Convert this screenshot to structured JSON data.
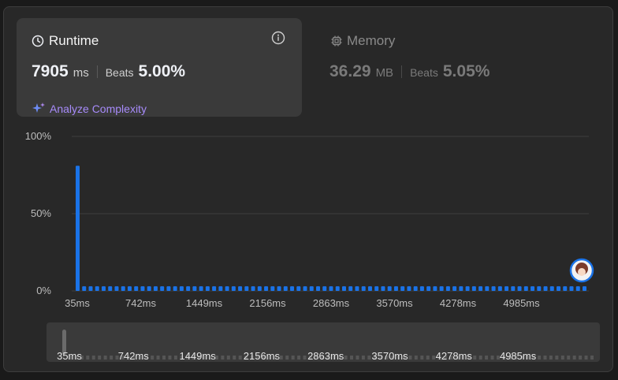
{
  "runtime": {
    "title": "Runtime",
    "value": "7905",
    "unit": "ms",
    "beats_label": "Beats",
    "beats_value": "5.00%",
    "analyze_label": "Analyze Complexity"
  },
  "memory": {
    "title": "Memory",
    "value": "36.29",
    "unit": "MB",
    "beats_label": "Beats",
    "beats_value": "5.05%"
  },
  "colors": {
    "bar": "#1a73e8",
    "analyze": "#a78bfa"
  },
  "chart_data": {
    "type": "bar",
    "yticks": [
      "100%",
      "50%",
      "0%"
    ],
    "ylim": [
      0,
      100
    ],
    "grid": true,
    "xticks": [
      "35ms",
      "742ms",
      "1449ms",
      "2156ms",
      "2863ms",
      "3570ms",
      "4278ms",
      "4985ms"
    ],
    "values": [
      81,
      3,
      3,
      3,
      3,
      3,
      3,
      3,
      3,
      3,
      3,
      3,
      3,
      3,
      3,
      3,
      3,
      3,
      3,
      3,
      3,
      3,
      3,
      3,
      3,
      3,
      3,
      3,
      3,
      3,
      3,
      3,
      3,
      3,
      3,
      3,
      3,
      3,
      3,
      3,
      3,
      3,
      3,
      3,
      3,
      3,
      3,
      3,
      3,
      3,
      3,
      3,
      3,
      3,
      3,
      3,
      3,
      3,
      3,
      3,
      3,
      3,
      3,
      3,
      3,
      3,
      3,
      3,
      3,
      3,
      3,
      3,
      3,
      3,
      3,
      3,
      3,
      3,
      3
    ]
  },
  "overview": {
    "xticks": [
      "35ms",
      "742ms",
      "1449ms",
      "2156ms",
      "2863ms",
      "3570ms",
      "4278ms",
      "4985ms"
    ]
  }
}
